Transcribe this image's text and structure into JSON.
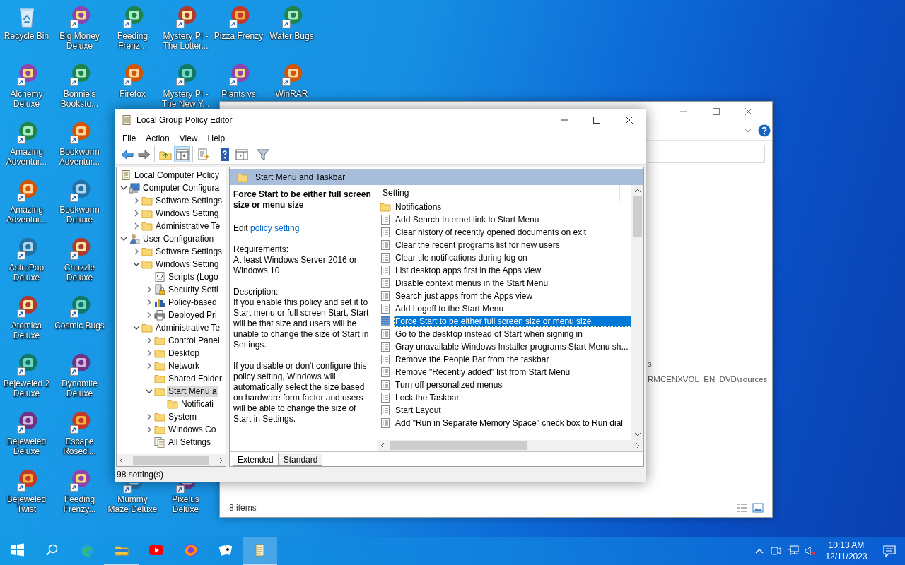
{
  "desktop": {
    "columns": [
      {
        "top": [
          {
            "label": "Recycle Bin",
            "kind": "bin"
          },
          {
            "label": "Alchemy Deluxe",
            "kind": "shortcut"
          },
          {
            "label": "Amazing Adventur...",
            "kind": "shortcut"
          },
          {
            "label": "Amazing Adventur...",
            "kind": "shortcut"
          },
          {
            "label": "AstroPop Deluxe",
            "kind": "shortcut"
          },
          {
            "label": "Atomica Deluxe",
            "kind": "shortcut"
          },
          {
            "label": "Bejeweled 2 Deluxe",
            "kind": "shortcut"
          },
          {
            "label": "Bejeweled Deluxe",
            "kind": "shortcut"
          },
          {
            "label": "Bejeweled Twist",
            "kind": "shortcut"
          }
        ]
      },
      {
        "top": [
          {
            "label": "Big Money Deluxe",
            "kind": "shortcut"
          },
          {
            "label": "Bonnie's Booksto...",
            "kind": "shortcut"
          },
          {
            "label": "Bookworm Adventur...",
            "kind": "shortcut"
          },
          {
            "label": "Bookworm Deluxe",
            "kind": "shortcut"
          },
          {
            "label": "Chuzzle Deluxe",
            "kind": "shortcut"
          },
          {
            "label": "Cosmic Bugs",
            "kind": "shortcut"
          },
          {
            "label": "Dynomite Deluxe",
            "kind": "shortcut"
          },
          {
            "label": "Escape Rosecl...",
            "kind": "shortcut"
          },
          {
            "label": "Feeding Frenzy...",
            "kind": "shortcut"
          }
        ]
      },
      {
        "top": [
          {
            "label": "Feeding Frenz...",
            "kind": "shortcut"
          },
          {
            "label": "Firefox",
            "kind": "shortcut"
          }
        ],
        "bottom": [
          {
            "label": "Mummy Maze Deluxe",
            "kind": "shortcut"
          }
        ]
      },
      {
        "top": [
          {
            "label": "Mystery PI - The Lotter...",
            "kind": "shortcut"
          },
          {
            "label": "Mystery PI - The New Y...",
            "kind": "shortcut"
          }
        ],
        "bottom": [
          {
            "label": "Pixelus Deluxe",
            "kind": "shortcut"
          }
        ]
      },
      {
        "top": [
          {
            "label": "Pizza Frenzy",
            "kind": "shortcut"
          },
          {
            "label": "Plants vs",
            "kind": "shortcut"
          }
        ]
      },
      {
        "top": [
          {
            "label": "Water Bugs",
            "kind": "shortcut"
          },
          {
            "label": "WinRAR",
            "kind": "shortcut"
          }
        ]
      }
    ]
  },
  "explorer_window": {
    "details": [
      "s",
      "RMCENXVOL_EN_DVD\\sources"
    ],
    "status": "8 items"
  },
  "gpe_window": {
    "title": "Local Group Policy Editor",
    "menu": [
      "File",
      "Action",
      "View",
      "Help"
    ],
    "toolbar": [
      [
        {
          "kind": "back",
          "pressed": false
        },
        {
          "kind": "forward",
          "pressed": false
        }
      ],
      [
        {
          "kind": "up",
          "pressed": false
        },
        {
          "kind": "tree",
          "pressed": true
        }
      ],
      [
        {
          "kind": "export",
          "pressed": false
        }
      ],
      [
        {
          "kind": "help",
          "pressed": false
        },
        {
          "kind": "view",
          "pressed": false
        }
      ],
      [
        {
          "kind": "filter",
          "pressed": false
        }
      ]
    ],
    "tree": [
      {
        "label": "Local Computer Policy",
        "kind": "policy",
        "selected": false,
        "children": [
          {
            "label": "Computer Configura",
            "kind": "computer",
            "expandable": true,
            "expanded": true,
            "selected": false,
            "children": [
              {
                "label": "Software Settings",
                "kind": "folder",
                "expandable": true,
                "expanded": false,
                "selected": false
              },
              {
                "label": "Windows Setting",
                "kind": "folder",
                "expandable": true,
                "expanded": false,
                "selected": false
              },
              {
                "label": "Administrative Te",
                "kind": "folder",
                "expandable": true,
                "expanded": false,
                "selected": false
              }
            ]
          },
          {
            "label": "User Configuration",
            "kind": "user",
            "expandable": true,
            "expanded": true,
            "selected": false,
            "children": [
              {
                "label": "Software Settings",
                "kind": "folder",
                "expandable": true,
                "expanded": false,
                "selected": false
              },
              {
                "label": "Windows Setting",
                "kind": "folder",
                "expandable": true,
                "expanded": true,
                "selected": false,
                "children": [
                  {
                    "label": "Scripts (Logo",
                    "kind": "script",
                    "expandable": false,
                    "selected": false
                  },
                  {
                    "label": "Security Setti",
                    "kind": "security",
                    "expandable": true,
                    "expanded": false,
                    "selected": false
                  },
                  {
                    "label": "Policy-based",
                    "kind": "chart",
                    "expandable": true,
                    "expanded": false,
                    "selected": false
                  },
                  {
                    "label": "Deployed Pri",
                    "kind": "printer",
                    "expandable": true,
                    "expanded": false,
                    "selected": false
                  }
                ]
              },
              {
                "label": "Administrative Te",
                "kind": "folder",
                "expandable": true,
                "expanded": true,
                "selected": false,
                "children": [
                  {
                    "label": "Control Panel",
                    "kind": "folder",
                    "expandable": true,
                    "expanded": false,
                    "selected": false
                  },
                  {
                    "label": "Desktop",
                    "kind": "folder",
                    "expandable": true,
                    "expanded": false,
                    "selected": false
                  },
                  {
                    "label": "Network",
                    "kind": "folder",
                    "expandable": true,
                    "expanded": false,
                    "selected": false
                  },
                  {
                    "label": "Shared Folder",
                    "kind": "folder",
                    "expandable": false,
                    "selected": false
                  },
                  {
                    "label": "Start Menu a",
                    "kind": "folder",
                    "expandable": true,
                    "expanded": true,
                    "selected": true,
                    "children": [
                      {
                        "label": "Notificati",
                        "kind": "folder",
                        "expandable": false,
                        "selected": false
                      }
                    ]
                  },
                  {
                    "label": "System",
                    "kind": "folder",
                    "expandable": true,
                    "expanded": false,
                    "selected": false
                  },
                  {
                    "label": "Windows Co",
                    "kind": "folder",
                    "expandable": true,
                    "expanded": false,
                    "selected": false
                  },
                  {
                    "label": "All Settings",
                    "kind": "settings",
                    "expandable": false,
                    "selected": false
                  }
                ]
              }
            ]
          }
        ]
      }
    ],
    "header": "Start Menu and Taskbar",
    "description": {
      "title": "Force Start to be either full screen size or menu size",
      "edit_prefix": "Edit",
      "edit_link": "policy setting",
      "requirements_label": "Requirements:",
      "requirements": "At least Windows Server 2016 or Windows 10",
      "description_label": "Description:",
      "paragraphs": [
        "If you enable this policy and set it to Start menu or full screen Start, Start will be that size and users will be unable to change the size of Start in Settings.",
        "If you disable or don't configure this policy setting, Windows will automatically select the size based on hardware form factor and users will be able to change the size of Start in Settings."
      ]
    },
    "settings": {
      "column": "Setting",
      "rows": [
        {
          "label": "Notifications",
          "kind": "folder",
          "selected": false
        },
        {
          "label": "Add Search Internet link to Start Menu",
          "kind": "setting",
          "selected": false
        },
        {
          "label": "Clear history of recently opened documents on exit",
          "kind": "setting",
          "selected": false
        },
        {
          "label": "Clear the recent programs list for new users",
          "kind": "setting",
          "selected": false
        },
        {
          "label": "Clear tile notifications during log on",
          "kind": "setting",
          "selected": false
        },
        {
          "label": "List desktop apps first in the Apps view",
          "kind": "setting",
          "selected": false
        },
        {
          "label": "Disable context menus in the Start Menu",
          "kind": "setting",
          "selected": false
        },
        {
          "label": "Search just apps from the Apps view",
          "kind": "setting",
          "selected": false
        },
        {
          "label": "Add Logoff to the Start Menu",
          "kind": "setting",
          "selected": false
        },
        {
          "label": "Force Start to be either full screen size or menu size",
          "kind": "setting",
          "selected": true
        },
        {
          "label": "Go to the desktop instead of Start when signing in",
          "kind": "setting",
          "selected": false
        },
        {
          "label": "Gray unavailable Windows Installer programs Start Menu sh...",
          "kind": "setting",
          "selected": false
        },
        {
          "label": "Remove the People Bar from the taskbar",
          "kind": "setting",
          "selected": false
        },
        {
          "label": "Remove \"Recently added\" list from Start Menu",
          "kind": "setting",
          "selected": false
        },
        {
          "label": "Turn off personalized menus",
          "kind": "setting",
          "selected": false
        },
        {
          "label": "Lock the Taskbar",
          "kind": "setting",
          "selected": false
        },
        {
          "label": "Start Layout",
          "kind": "setting",
          "selected": false
        },
        {
          "label": "Add \"Run in Separate Memory Space\" check box to Run dial",
          "kind": "setting",
          "selected": false
        }
      ]
    },
    "view_tabs": [
      {
        "label": "Extended",
        "selected": true
      },
      {
        "label": "Standard",
        "selected": false
      }
    ],
    "status_bar": "98 setting(s)"
  },
  "taskbar": {
    "items": [
      {
        "kind": "start",
        "running": false,
        "active": false
      },
      {
        "kind": "search",
        "running": false,
        "active": false
      },
      {
        "kind": "edge",
        "running": false,
        "active": false
      },
      {
        "kind": "explorer",
        "running": true,
        "active": false
      },
      {
        "kind": "youtube",
        "running": false,
        "active": false
      },
      {
        "kind": "firefox",
        "running": false,
        "active": false
      },
      {
        "kind": "cards",
        "running": false,
        "active": false
      },
      {
        "kind": "notepad",
        "running": true,
        "active": true
      }
    ],
    "tray": [
      {
        "kind": "chevron"
      },
      {
        "kind": "meet"
      },
      {
        "kind": "network"
      },
      {
        "kind": "volume_muted"
      }
    ],
    "clock": {
      "time": "10:13 AM",
      "date": "12/11/2023"
    }
  }
}
